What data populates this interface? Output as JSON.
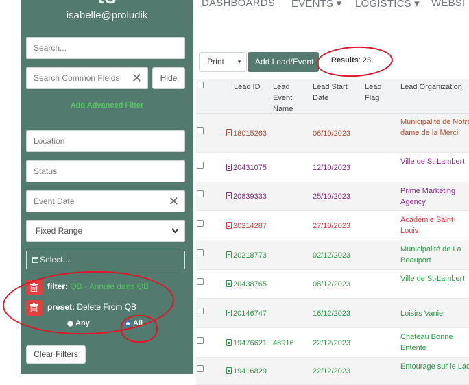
{
  "colors": {
    "sidebar_bg": "#527a6f",
    "accent_green": "#54c85c",
    "danger": "#e0413b",
    "annotation": "#e0162a",
    "status_brown": "#b0502c",
    "status_purple": "#8a2b8a",
    "status_red": "#e03a3a",
    "status_green": "#2e9a46"
  },
  "sidebar": {
    "logo": "to",
    "user_email": "isabelle@proludik",
    "search_placeholder": "Search...",
    "common_fields_placeholder": "Search Common Fields",
    "hide_label": "Hide",
    "add_filter_label": "Add Advanced Filter",
    "location_placeholder": "Location",
    "status_placeholder": "Status",
    "event_date_placeholder": "Event Date",
    "range_select": "Fixed Range",
    "date_select": "Select...",
    "filters": [
      {
        "key": "filter:",
        "value": "QB - Annulé dans QB"
      },
      {
        "key": "preset:",
        "value": "Delete From QB"
      }
    ],
    "radio_any": "Any",
    "radio_all": "All",
    "clear_filters_label": "Clear Filters"
  },
  "topnav": {
    "items": [
      "DASHBOARDS",
      "EVENTS ▾",
      "LOGISTICS ▾",
      "WEBSI"
    ]
  },
  "toolbar": {
    "print_label": "Print",
    "caret": "▾",
    "add_lead_label": "Add Lead/Event",
    "results_label": "Results",
    "results_count": ": 23"
  },
  "table": {
    "headers": {
      "lead_id": "Lead ID",
      "event_name": "Lead Event Name",
      "start_date": "Lead Start Date",
      "flag": "Lead Flag",
      "organization": "Lead Organization"
    },
    "rows": [
      {
        "id": "18015263",
        "event": "",
        "date": "06/10/2023",
        "org": "Municipalité de Notre dame de la Merci",
        "status": "brown"
      },
      {
        "id": "20431075",
        "event": "",
        "date": "12/10/2023",
        "org": "Ville de St-Lambert",
        "status": "purple"
      },
      {
        "id": "20839333",
        "event": "",
        "date": "25/10/2023",
        "org": "Prime Marketing Agency",
        "status": "purple"
      },
      {
        "id": "20214287",
        "event": "",
        "date": "27/10/2023",
        "org": "Académie Saint-Louis",
        "status": "red"
      },
      {
        "id": "20218773",
        "event": "",
        "date": "02/12/2023",
        "org": "Municipalité de La Beauport",
        "status": "green"
      },
      {
        "id": "20438765",
        "event": "",
        "date": "08/12/2023",
        "org": "Ville de St-Lambert",
        "status": "green"
      },
      {
        "id": "20146747",
        "event": "",
        "date": "16/12/2023",
        "org": "Loisirs Vanier",
        "status": "green"
      },
      {
        "id": "19476621",
        "event": "48916",
        "date": "22/12/2023",
        "org": "Chateau Bonne Entente",
        "status": "green"
      },
      {
        "id": "19416829",
        "event": "",
        "date": "22/12/2023",
        "org": "Entourage sur le Lac",
        "status": "green"
      }
    ]
  }
}
